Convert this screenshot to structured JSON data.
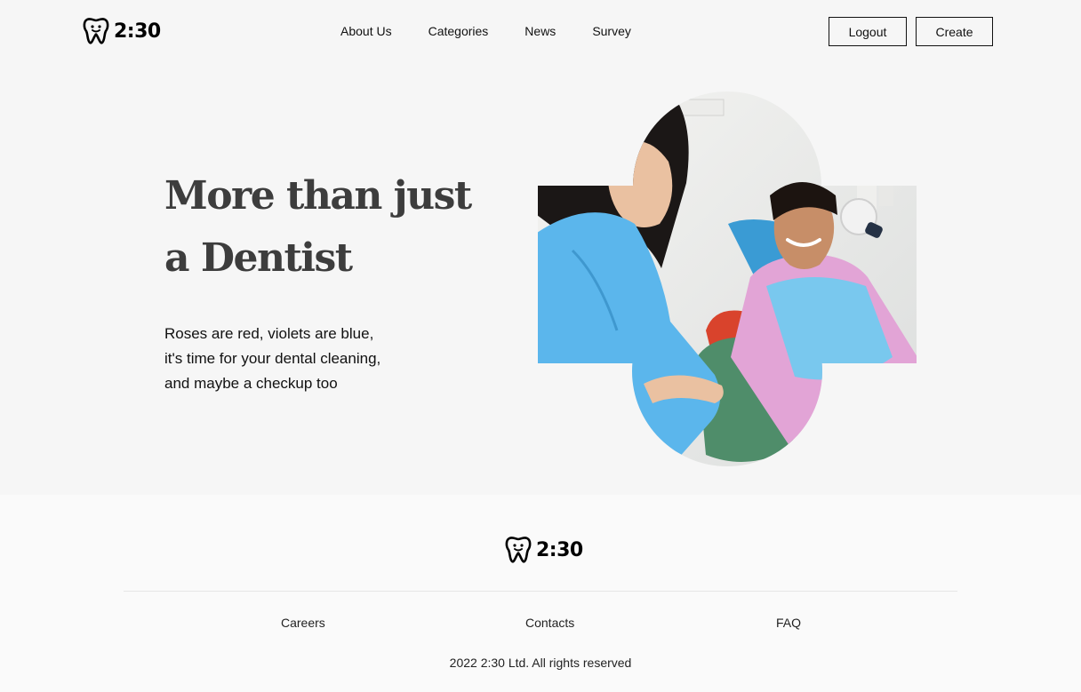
{
  "brand": {
    "logo_text": "2:30"
  },
  "nav": {
    "items": [
      {
        "label": "About Us"
      },
      {
        "label": "Categories"
      },
      {
        "label": "News"
      },
      {
        "label": "Survey"
      }
    ]
  },
  "actions": {
    "logout_label": "Logout",
    "create_label": "Create"
  },
  "hero": {
    "title": "More than just a Dentist",
    "lines": [
      "Roses are red, violets are blue,",
      "it's time for your dental cleaning,",
      "and maybe a checkup too"
    ]
  },
  "footer": {
    "links": [
      {
        "label": "Careers"
      },
      {
        "label": "Contacts"
      },
      {
        "label": "FAQ"
      }
    ],
    "copyright": "2022 2:30 Ltd. All rights reserved"
  },
  "colors": {
    "background": "#f6f6f6",
    "footer_background": "#fafafa",
    "text": "#111111",
    "heading": "#3d3d3d",
    "uniform_blue": "#5bb6ec",
    "bib_blue": "#79c8ee",
    "bib_pink": "#e2a4d6"
  }
}
